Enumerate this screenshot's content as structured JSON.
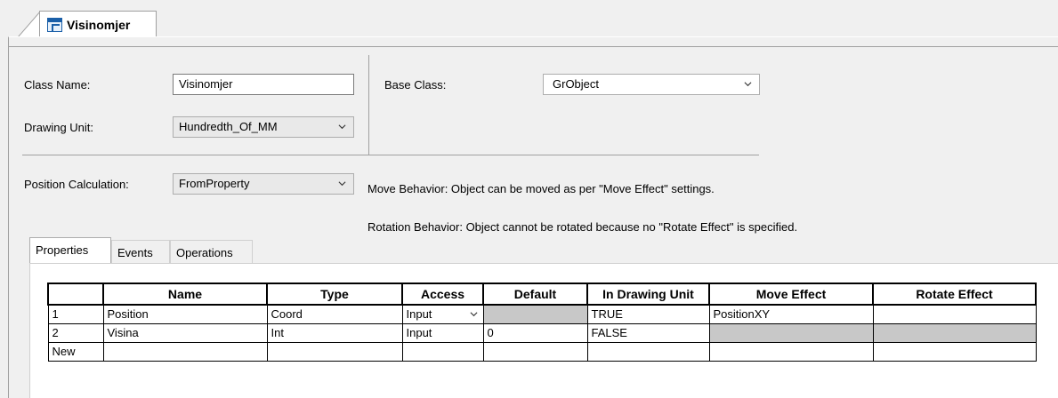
{
  "document_tab": {
    "title": "Visinomjer",
    "icon": "class-icon"
  },
  "form": {
    "class_name_label": "Class Name:",
    "class_name_value": "Visinomjer",
    "base_class_label": "Base Class:",
    "base_class_value": "GrObject",
    "drawing_unit_label": "Drawing Unit:",
    "drawing_unit_value": "Hundredth_Of_MM",
    "position_calc_label": "Position Calculation:",
    "position_calc_value": "FromProperty",
    "move_behavior": "Move Behavior: Object can be moved as per \"Move Effect\" settings.",
    "rotation_behavior": "Rotation Behavior: Object cannot be rotated because no \"Rotate Effect\" is specified."
  },
  "subtabs": [
    {
      "label": "Properties",
      "active": true
    },
    {
      "label": "Events",
      "active": false
    },
    {
      "label": "Operations",
      "active": false
    }
  ],
  "grid": {
    "columns": [
      "Name",
      "Type",
      "Access",
      "Default",
      "In Drawing Unit",
      "Move Effect",
      "Rotate Effect"
    ],
    "rows": [
      {
        "index": "1",
        "name": "Position",
        "type": "Coord",
        "access": "Input",
        "default": "",
        "in_drawing_unit": "TRUE",
        "move_effect": "PositionXY",
        "rotate_effect": ""
      },
      {
        "index": "2",
        "name": "Visina",
        "type": "Int",
        "access": "Input",
        "default": "0",
        "in_drawing_unit": "FALSE",
        "move_effect": "",
        "rotate_effect": ""
      },
      {
        "index": "New",
        "name": "",
        "type": "",
        "access": "",
        "default": "",
        "in_drawing_unit": "",
        "move_effect": "",
        "rotate_effect": ""
      }
    ]
  },
  "colors": {
    "border": "#a0a0a0",
    "disabled_cell": "#c8c8c8",
    "tab_icon": "#1a5fa8"
  }
}
